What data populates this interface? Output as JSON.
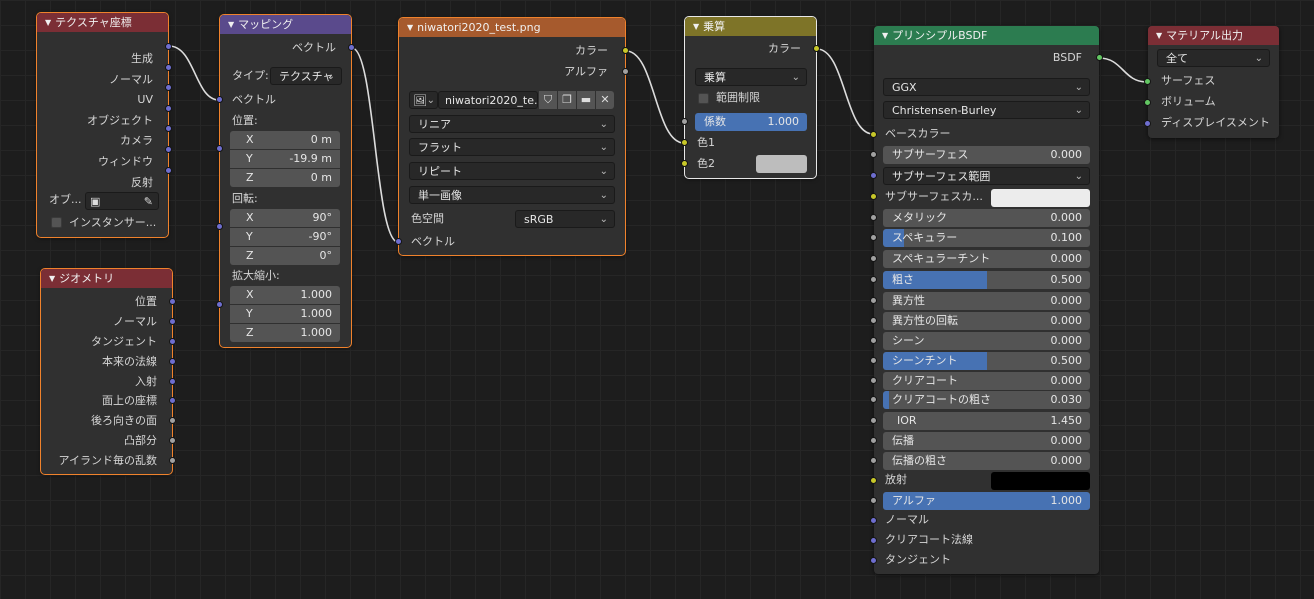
{
  "colors": {
    "header_red": "#7b2e35",
    "header_purple": "#5a4a8c",
    "header_orange": "#a65a2d",
    "header_olive": "#7e7428",
    "header_green": "#2c7c50",
    "socket_vector": "#6e6ecf",
    "socket_color": "#c7c729",
    "socket_float": "#a1a1a1",
    "socket_shader": "#63c763",
    "slider_fill": "#4772b3"
  },
  "texcoord": {
    "title": "テクスチャ座標",
    "outputs": [
      "生成",
      "ノーマル",
      "UV",
      "オブジェクト",
      "カメラ",
      "ウィンドウ",
      "反射"
    ],
    "object_label": "オブ...",
    "object_picker_icon": "eyedropper-icon",
    "instancer_label": "インスタンサー..."
  },
  "geometry": {
    "title": "ジオメトリ",
    "outputs": [
      "位置",
      "ノーマル",
      "タンジェント",
      "本来の法線",
      "入射",
      "面上の座標",
      "後ろ向きの面",
      "凸部分",
      "アイランド毎の乱数"
    ]
  },
  "mapping": {
    "title": "マッピング",
    "output": "ベクトル",
    "type_label": "タイプ:",
    "type_value": "テクスチャ",
    "input_vector": "ベクトル",
    "location_label": "位置:",
    "location": [
      {
        "axis": "X",
        "value": "0 m"
      },
      {
        "axis": "Y",
        "value": "-19.9 m"
      },
      {
        "axis": "Z",
        "value": "0 m"
      }
    ],
    "rotation_label": "回転:",
    "rotation": [
      {
        "axis": "X",
        "value": "90°"
      },
      {
        "axis": "Y",
        "value": "-90°"
      },
      {
        "axis": "Z",
        "value": "0°"
      }
    ],
    "scale_label": "拡大縮小:",
    "scale": [
      {
        "axis": "X",
        "value": "1.000"
      },
      {
        "axis": "Y",
        "value": "1.000"
      },
      {
        "axis": "Z",
        "value": "1.000"
      }
    ]
  },
  "image": {
    "title": "niwatori2020_test.png",
    "out_color": "カラー",
    "out_alpha": "アルファ",
    "image_name": "niwatori2020_te...",
    "interpolation": "リニア",
    "projection": "フラット",
    "extension": "リピート",
    "source": "単一画像",
    "colorspace_label": "色空間",
    "colorspace_value": "sRGB",
    "input_vector": "ベクトル"
  },
  "mix": {
    "title": "乗算",
    "out_color": "カラー",
    "blend_type": "乗算",
    "clamp_label": "範囲制限",
    "fac_label": "係数",
    "fac_value": "1.000",
    "color1": "色1",
    "color2": "色2"
  },
  "bsdf": {
    "title": "プリンシプルBSDF",
    "output": "BSDF",
    "distribution": "GGX",
    "subsurface_method": "Christensen-Burley",
    "base_color": "ベースカラー",
    "subsurface": {
      "label": "サブサーフェス",
      "value": "0.000"
    },
    "subsurface_radius": "サブサーフェス範囲",
    "subsurface_color": "サブサーフェスカ...",
    "metallic": {
      "label": "メタリック",
      "value": "0.000"
    },
    "specular": {
      "label": "スペキュラー",
      "value": "0.100",
      "fill": 0.1
    },
    "specular_tint": {
      "label": "スペキュラーチント",
      "value": "0.000"
    },
    "roughness": {
      "label": "粗さ",
      "value": "0.500",
      "fill": 0.5
    },
    "anisotropic": {
      "label": "異方性",
      "value": "0.000"
    },
    "anisotropic_rotation": {
      "label": "異方性の回転",
      "value": "0.000"
    },
    "sheen": {
      "label": "シーン",
      "value": "0.000"
    },
    "sheen_tint": {
      "label": "シーンチント",
      "value": "0.500",
      "fill": 0.5
    },
    "clearcoat": {
      "label": "クリアコート",
      "value": "0.000"
    },
    "clearcoat_roughness": {
      "label": "クリアコートの粗さ",
      "value": "0.030",
      "fill": 0.03
    },
    "ior": {
      "label": "IOR",
      "value": "1.450"
    },
    "transmission": {
      "label": "伝播",
      "value": "0.000"
    },
    "transmission_roughness": {
      "label": "伝播の粗さ",
      "value": "0.000"
    },
    "emission": "放射",
    "alpha": {
      "label": "アルファ",
      "value": "1.000",
      "fill": 1.0
    },
    "normal": "ノーマル",
    "clearcoat_normal": "クリアコート法線",
    "tangent": "タンジェント"
  },
  "output": {
    "title": "マテリアル出力",
    "target": "全て",
    "surface": "サーフェス",
    "volume": "ボリューム",
    "displacement": "ディスプレイスメント"
  }
}
